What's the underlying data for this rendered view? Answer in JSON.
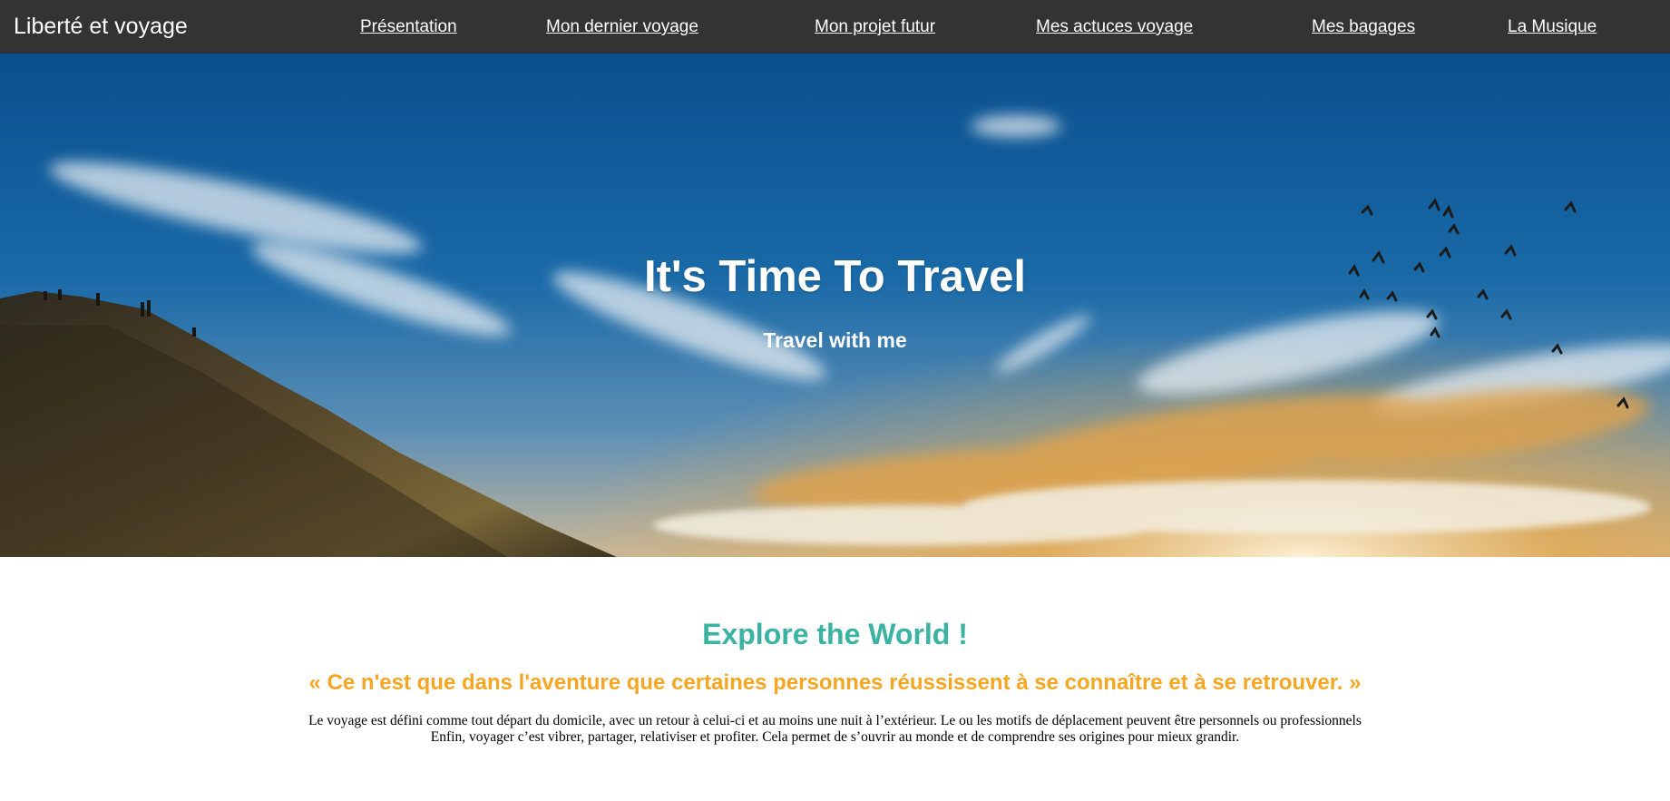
{
  "header": {
    "brand": "Liberté et voyage",
    "nav": [
      {
        "label": "Présentation"
      },
      {
        "label": "Mon dernier voyage"
      },
      {
        "label": "Mon projet futur"
      },
      {
        "label": "Mes actuces voyage"
      },
      {
        "label": "Mes bagages"
      },
      {
        "label": "La Musique"
      }
    ]
  },
  "hero": {
    "title": "It's Time To Travel",
    "subtitle": "Travel with me"
  },
  "main": {
    "title": "Explore the World !",
    "quote": "« Ce n'est que dans l'aventure que certaines personnes réussissent à se connaître et à se retrouver. »",
    "paragraph_lines": [
      "Le voyage est défini comme tout départ du domicile, avec un retour à celui-ci et au moins une nuit à l’extérieur. Le ou les motifs de déplacement peuvent être personnels ou professionnels",
      "Enfin, voyager c’est vibrer, partager, relativiser et profiter. Cela permet de s’ouvrir au monde et de comprendre ses origines pour mieux grandir."
    ]
  },
  "colors": {
    "navbar_bg": "#333333",
    "title_teal": "#3ab3a3",
    "quote_orange": "#f5a623",
    "text": "#000000"
  }
}
